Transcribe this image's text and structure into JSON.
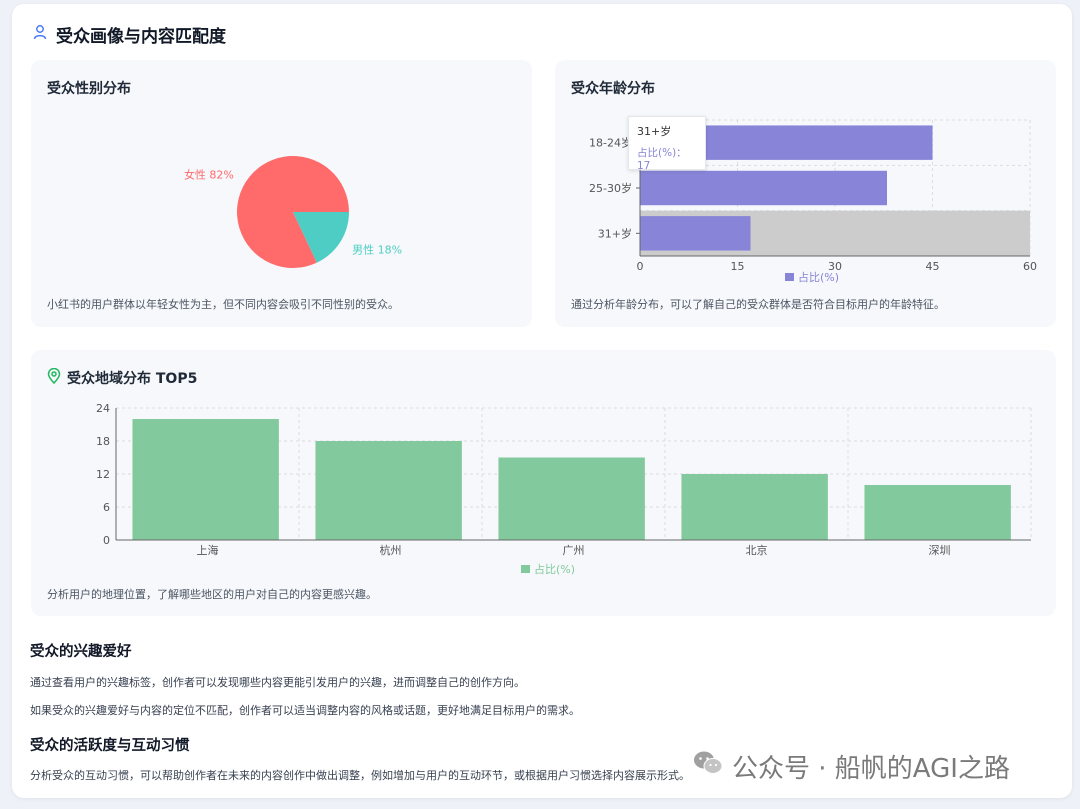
{
  "page": {
    "title": "受众画像与内容匹配度",
    "icon": "user-icon",
    "accent": "#4a7bf7"
  },
  "gender": {
    "title": "受众性别分布",
    "desc": "小红书的用户群体以年轻女性为主，但不同内容会吸引不同性别的受众。"
  },
  "age": {
    "title": "受众年龄分布",
    "desc": "通过分析年龄分布，可以了解自己的受众群体是否符合目标用户的年龄特征。",
    "tooltip": {
      "title": "31+岁",
      "line": "占比(%)：17"
    }
  },
  "region": {
    "title": "受众地域分布 TOP5",
    "icon": "location-pin-icon",
    "desc": "分析用户的地理位置，了解哪些地区的用户对自己的内容更感兴趣。"
  },
  "interest": {
    "title": "受众的兴趣爱好",
    "p1": "通过查看用户的兴趣标签，创作者可以发现哪些内容更能引发用户的兴趣，进而调整自己的创作方向。",
    "p2": "如果受众的兴趣爱好与内容的定位不匹配，创作者可以适当调整内容的风格或话题，更好地满足目标用户的需求。"
  },
  "activity": {
    "title": "受众的活跃度与互动习惯",
    "p1": "分析受众的互动习惯，可以帮助创作者在未来的内容创作中做出调整，例如增加与用户的互动环节，或根据用户习惯选择内容展示形式。"
  },
  "watermark": {
    "text": "公众号 · 船帆的AGI之路",
    "icon": "wechat-icon"
  },
  "chart_data": [
    {
      "type": "pie",
      "categories": [
        "女性",
        "男性"
      ],
      "values": [
        82,
        18
      ],
      "labels": [
        "女性 82%",
        "男性 18%"
      ],
      "colors": [
        "#ff6b6b",
        "#4ecdc4"
      ]
    },
    {
      "type": "bar",
      "orientation": "horizontal",
      "categories": [
        "18-24岁",
        "25-30岁",
        "31+岁"
      ],
      "series": [
        {
          "name": "占比(%)",
          "values": [
            45,
            38,
            17
          ],
          "color": "#8884d8"
        }
      ],
      "xlim": [
        0,
        60
      ],
      "xticks": [
        0,
        15,
        30,
        45,
        60
      ],
      "legend": "bottom",
      "grid": true,
      "highlighted_category": "31+岁"
    },
    {
      "type": "bar",
      "categories": [
        "上海",
        "杭州",
        "广州",
        "北京",
        "深圳"
      ],
      "series": [
        {
          "name": "占比(%)",
          "values": [
            22,
            18,
            15,
            12,
            10
          ],
          "color": "#82ca9d"
        }
      ],
      "ylim": [
        0,
        24
      ],
      "yticks": [
        0,
        6,
        12,
        18,
        24
      ],
      "legend": "bottom",
      "grid": true
    }
  ]
}
